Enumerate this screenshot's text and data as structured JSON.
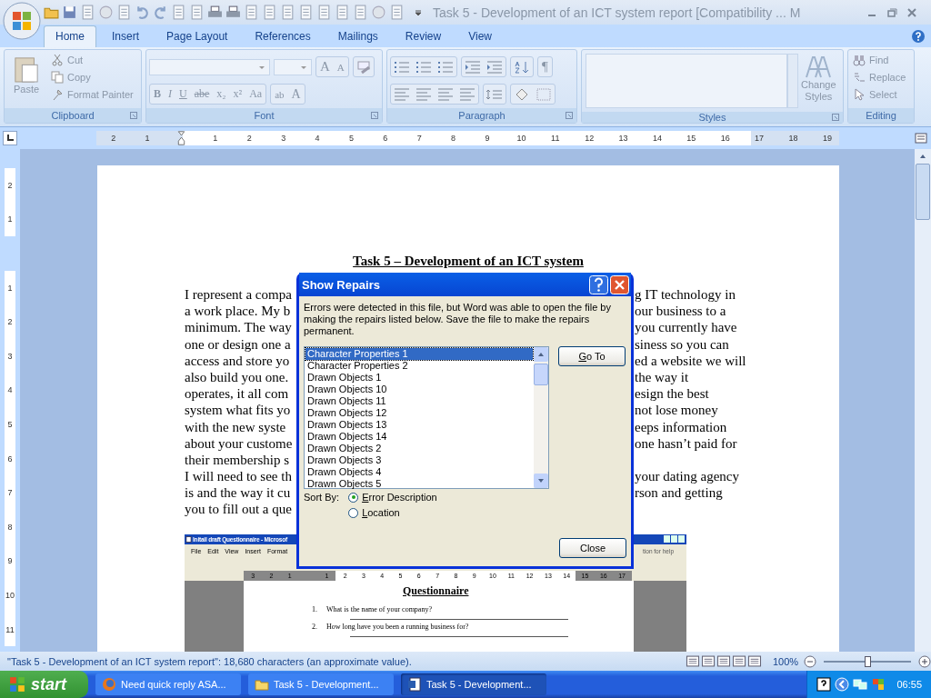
{
  "window": {
    "title": "Task 5 - Development of an ICT system report [Compatibility ... M"
  },
  "tabs": [
    {
      "label": "Home",
      "selected": true
    },
    {
      "label": "Insert",
      "selected": false
    },
    {
      "label": "Page Layout",
      "selected": false
    },
    {
      "label": "References",
      "selected": false
    },
    {
      "label": "Mailings",
      "selected": false
    },
    {
      "label": "Review",
      "selected": false
    },
    {
      "label": "View",
      "selected": false
    }
  ],
  "clipboard": {
    "paste": "Paste",
    "actions": [
      "Cut",
      "Copy",
      "Format Painter"
    ],
    "label": "Clipboard"
  },
  "font": {
    "grow": "A",
    "shrink": "A",
    "styles": [
      "B",
      "I",
      "U",
      "abe",
      "x₂",
      "x²",
      "Aa"
    ],
    "highlight": "ab",
    "text_color": "A",
    "label": "Font"
  },
  "paragraph": {
    "pilcrow": "¶",
    "label": "Paragraph"
  },
  "styles": {
    "change": "Change Styles",
    "label": "Styles"
  },
  "editing": {
    "actions": [
      "Find",
      "Replace",
      "Select"
    ],
    "label": "Editing"
  },
  "ruler": {
    "before": [
      "2",
      "1"
    ],
    "marks": [
      "1",
      "2",
      "3",
      "4",
      "5",
      "6",
      "7",
      "8",
      "9",
      "10",
      "11",
      "12",
      "13",
      "14",
      "15",
      "16",
      "17",
      "18",
      "19"
    ]
  },
  "vertical_ruler": {
    "before": [
      "2",
      "1"
    ],
    "marks": [
      "1",
      "2",
      "3",
      "4",
      "5",
      "6",
      "7",
      "8",
      "9",
      "10",
      "11"
    ]
  },
  "document": {
    "title": "Task 5 – Development of an ICT system",
    "lines": [
      {
        "left": "I represent a compa",
        "right": "g IT technology in"
      },
      {
        "left": "a work place.  My b",
        "right": "our business to a"
      },
      {
        "left": "minimum.  The way",
        "right": "you currently have"
      },
      {
        "left": "one or design one a",
        "right": "siness so you can"
      },
      {
        "left": "access and store yo",
        "right": "ed a website we will"
      },
      {
        "left": "also build you one.",
        "right": "the way it"
      },
      {
        "left": "operates, it all com",
        "right": "esign the best"
      },
      {
        "left": "system what fits yo",
        "right": "not lose money"
      },
      {
        "left": "with the new syste",
        "right": "eeps information"
      },
      {
        "left": "about your custome",
        "right": "one hasn’t paid for"
      },
      {
        "left": "their membership  s"
      },
      {
        "left": "I will need to see th",
        "right": "your dating agency"
      },
      {
        "left": "is and the way it cu",
        "right": "rson and getting"
      },
      {
        "left": "you to fill out a que"
      }
    ]
  },
  "embedded_window": {
    "title": "Initail draft Questionnaire - Microsof",
    "menu": [
      "File",
      "Edit",
      "View",
      "Insert",
      "Format"
    ],
    "help": "tion for help",
    "ruler": {
      "before": [
        "3",
        "2",
        "1"
      ],
      "marks": [
        "1",
        "2",
        "3",
        "4",
        "5",
        "6",
        "7",
        "8",
        "9",
        "10",
        "11",
        "12",
        "13",
        "14",
        "15",
        "16",
        "17"
      ]
    },
    "heading": "Questionnaire",
    "questions": [
      {
        "number": "1.",
        "text": "What is the name of your company?"
      },
      {
        "number": "2.",
        "text": "How long have you been a running business for?"
      }
    ]
  },
  "dialog": {
    "title": "Show Repairs",
    "message": "Errors were detected in this file, but Word was able to open the file by making the repairs listed below.  Save the file to make the repairs permanent.",
    "items": [
      {
        "label": "Character Properties 1",
        "selected": true
      },
      {
        "label": "Character Properties 2",
        "selected": false
      },
      {
        "label": "Drawn Objects 1",
        "selected": false
      },
      {
        "label": "Drawn Objects 10",
        "selected": false
      },
      {
        "label": "Drawn Objects 11",
        "selected": false
      },
      {
        "label": "Drawn Objects 12",
        "selected": false
      },
      {
        "label": "Drawn Objects 13",
        "selected": false
      },
      {
        "label": "Drawn Objects 14",
        "selected": false
      },
      {
        "label": "Drawn Objects 2",
        "selected": false
      },
      {
        "label": "Drawn Objects 3",
        "selected": false
      },
      {
        "label": "Drawn Objects 4",
        "selected": false
      },
      {
        "label": "Drawn Objects 5",
        "selected": false
      }
    ],
    "go_to": "Go To",
    "sort_label": "Sort By:",
    "sort_options": [
      {
        "label": "Error Description",
        "selected": true
      },
      {
        "label": "Location",
        "selected": false
      }
    ],
    "close": "Close"
  },
  "status_bar": {
    "text": "\"Task 5 - Development of an ICT system report\": 18,680 characters (an approximate value).",
    "zoom": "100%",
    "level": 0.5
  },
  "taskbar": {
    "start": "start",
    "tasks": [
      {
        "label": "Need quick reply ASA...",
        "kind": "browser",
        "selected": false
      },
      {
        "label": "Task 5 - Development...",
        "kind": "folder",
        "selected": false
      },
      {
        "label": "Task 5 - Development...",
        "kind": "word",
        "selected": true
      }
    ],
    "clock": "06:55"
  }
}
